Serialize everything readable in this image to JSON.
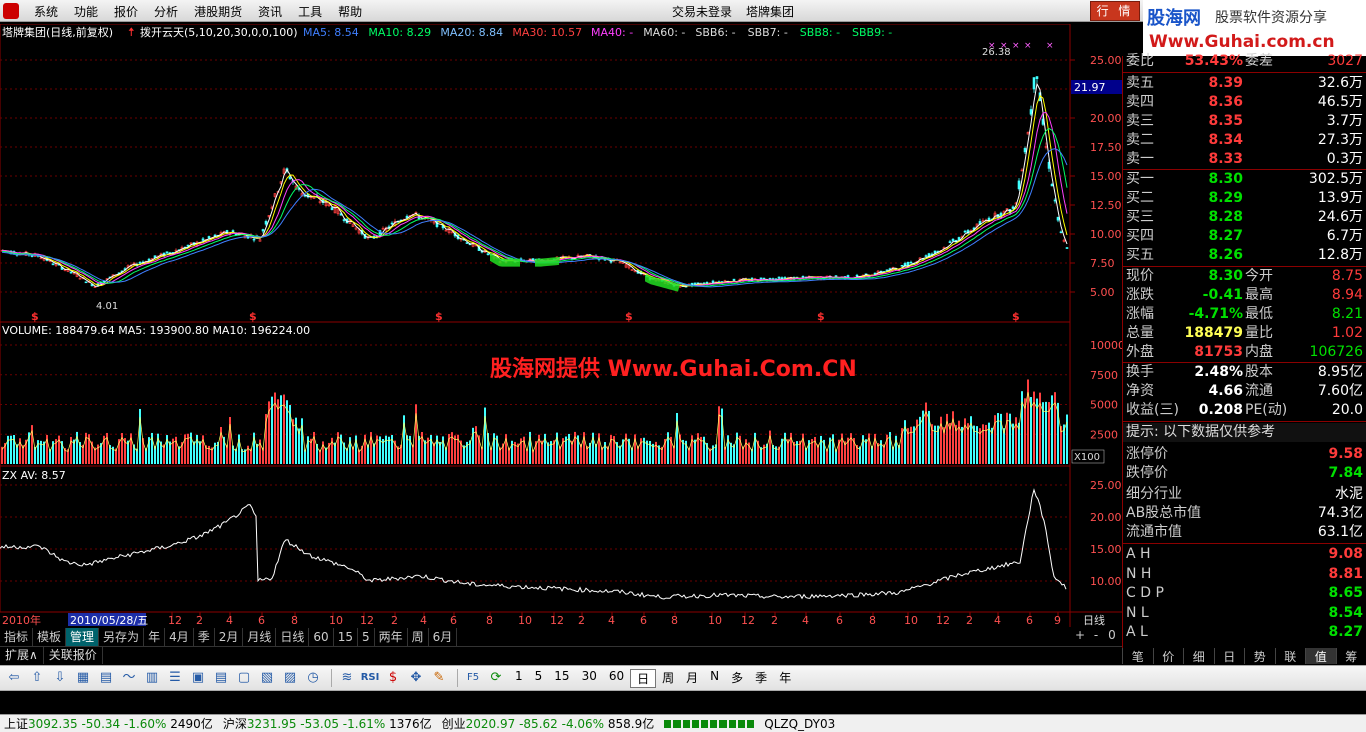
{
  "menubar": {
    "items": [
      "系统",
      "功能",
      "报价",
      "分析",
      "港股期货",
      "资讯",
      "工具",
      "帮助"
    ],
    "center": [
      "交易未登录",
      "塔牌集团"
    ],
    "quote_button": "行 情"
  },
  "brand": {
    "name": "股海网",
    "slogan": "股票软件资源分享",
    "url": "Www.Guhai.com.cn"
  },
  "chart": {
    "title_prefix": "塔牌集团(日线,前复权)",
    "indicator_name": "拨开云天(5,10,20,30,0,0,100)",
    "ma_labels": [
      {
        "text": "MA5: 8.54",
        "color": "#3f7fff"
      },
      {
        "text": "MA10: 8.29",
        "color": "#00ff66"
      },
      {
        "text": "MA20: 8.84",
        "color": "#80c0ff"
      },
      {
        "text": "MA30: 10.57",
        "color": "#ff4040"
      },
      {
        "text": "MA40: -",
        "color": "#ff40ff"
      },
      {
        "text": "MA60: -",
        "color": "#dddddd"
      },
      {
        "text": "SBB6: -",
        "color": "#dddddd"
      },
      {
        "text": "SBB7: -",
        "color": "#dddddd"
      },
      {
        "text": "SBB8: -",
        "color": "#00ff66"
      },
      {
        "text": "SBB9: -",
        "color": "#00ff66"
      }
    ],
    "price_axis": [
      "25.00",
      "22.50",
      "20.00",
      "17.50",
      "15.00",
      "12.50",
      "10.00",
      "7.50",
      "5.00"
    ],
    "last_price_tag": "21.97",
    "high_label": "26.38",
    "low_label": "4.01",
    "volume_title": "VOLUME: 188479.64  MA5: 193900.80  MA10: 196224.00",
    "volume_axis": [
      "10000",
      "7500",
      "5000",
      "2500"
    ],
    "volume_unit": "X100",
    "zx_title": "ZX AV: 8.57",
    "zx_axis": [
      "25.00",
      "20.00",
      "15.00",
      "10.00"
    ],
    "watermark": "股海网提供 Www.Guhai.Com.CN",
    "date_axis_year": "2010年",
    "date_axis_cursor": "2010/05/28/五",
    "date_axis_months": [
      "12",
      "2",
      "4",
      "6",
      "8",
      "10",
      "12",
      "2",
      "4",
      "6",
      "8",
      "10",
      "12",
      "2",
      "4",
      "6",
      "8",
      "10",
      "12",
      "2",
      "4",
      "6",
      "8",
      "10",
      "12",
      "2",
      "4",
      "6",
      "9"
    ],
    "period_label": "日线"
  },
  "panel": {
    "weibi": {
      "l1": "委比",
      "v1": "53.43%",
      "l2": "委差",
      "v2": "3027"
    },
    "sell": [
      {
        "label": "卖五",
        "price": "8.39",
        "vol": "32.6万"
      },
      {
        "label": "卖四",
        "price": "8.36",
        "vol": "46.5万"
      },
      {
        "label": "卖三",
        "price": "8.35",
        "vol": "3.7万"
      },
      {
        "label": "卖二",
        "price": "8.34",
        "vol": "27.3万"
      },
      {
        "label": "卖一",
        "price": "8.33",
        "vol": "0.3万"
      }
    ],
    "buy": [
      {
        "label": "买一",
        "price": "8.30",
        "vol": "302.5万"
      },
      {
        "label": "买二",
        "price": "8.29",
        "vol": "13.9万"
      },
      {
        "label": "买三",
        "price": "8.28",
        "vol": "24.6万"
      },
      {
        "label": "买四",
        "price": "8.27",
        "vol": "6.7万"
      },
      {
        "label": "买五",
        "price": "8.26",
        "vol": "12.8万"
      }
    ],
    "stats": [
      {
        "l1": "现价",
        "v1": "8.30",
        "c1": "grn",
        "l2": "今开",
        "v2": "8.75",
        "c2": "red"
      },
      {
        "l1": "涨跌",
        "v1": "-0.41",
        "c1": "grn",
        "l2": "最高",
        "v2": "8.94",
        "c2": "red"
      },
      {
        "l1": "涨幅",
        "v1": "-4.71%",
        "c1": "grn",
        "l2": "最低",
        "v2": "8.21",
        "c2": "grn"
      },
      {
        "l1": "总量",
        "v1": "188479",
        "c1": "yel",
        "l2": "量比",
        "v2": "1.02",
        "c2": "red"
      },
      {
        "l1": "外盘",
        "v1": "81753",
        "c1": "red",
        "l2": "内盘",
        "v2": "106726",
        "c2": "grn"
      }
    ],
    "stats2": [
      {
        "l1": "换手",
        "v1": "2.48%",
        "l2": "股本",
        "v2": "8.95亿"
      },
      {
        "l1": "净资",
        "v1": "4.66",
        "l2": "流通",
        "v2": "7.60亿"
      },
      {
        "l1": "收益(三)",
        "v1": "0.208",
        "l2": "PE(动)",
        "v2": "20.0"
      }
    ],
    "tip": "提示: 以下数据仅供参考",
    "limit_up": {
      "label": "涨停价",
      "value": "9.58"
    },
    "limit_down": {
      "label": "跌停价",
      "value": "7.84"
    },
    "industry": {
      "label": "细分行业",
      "value": "水泥"
    },
    "ab_mktcap": {
      "label": "AB股总市值",
      "value": "74.3亿"
    },
    "float_mktcap": {
      "label": "流通市值",
      "value": "63.1亿"
    },
    "indicators": [
      {
        "label": "A H",
        "value": "9.08",
        "color": "red"
      },
      {
        "label": "N H",
        "value": "8.81",
        "color": "red"
      },
      {
        "label": "C D P",
        "value": "8.65",
        "color": "grn"
      },
      {
        "label": "N L",
        "value": "8.54",
        "color": "grn"
      },
      {
        "label": "A L",
        "value": "8.27",
        "color": "grn"
      }
    ],
    "tabs": [
      "笔",
      "价",
      "细",
      "日",
      "势",
      "联",
      "值",
      "筹"
    ]
  },
  "period_bar": [
    "指标",
    "模板",
    "管理",
    "另存为",
    "年",
    "4月",
    "季",
    "2月",
    "月线",
    "日线",
    "60",
    "15",
    "5",
    "两年",
    "周",
    "6月"
  ],
  "period_ctrl": [
    "+",
    "-",
    "0"
  ],
  "ext_bar": [
    "扩展∧",
    "关联报价"
  ],
  "toolbar_text": [
    "1",
    "5",
    "15",
    "30",
    "60",
    "日",
    "周",
    "月",
    "N",
    "多",
    "季",
    "年"
  ],
  "status": {
    "sh": {
      "name": "上证",
      "price": "3092.35",
      "chg": "-50.34",
      "pct": "-1.60%",
      "amt": "2490亿"
    },
    "sz": {
      "name": "沪深",
      "price": "3231.95",
      "chg": "-53.05",
      "pct": "-1.61%",
      "amt": "1376亿"
    },
    "cy": {
      "name": "创业",
      "price": "2020.97",
      "chg": "-85.62",
      "pct": "-4.06%",
      "amt": "858.9亿"
    },
    "code": "QLZQ_DY03"
  }
}
